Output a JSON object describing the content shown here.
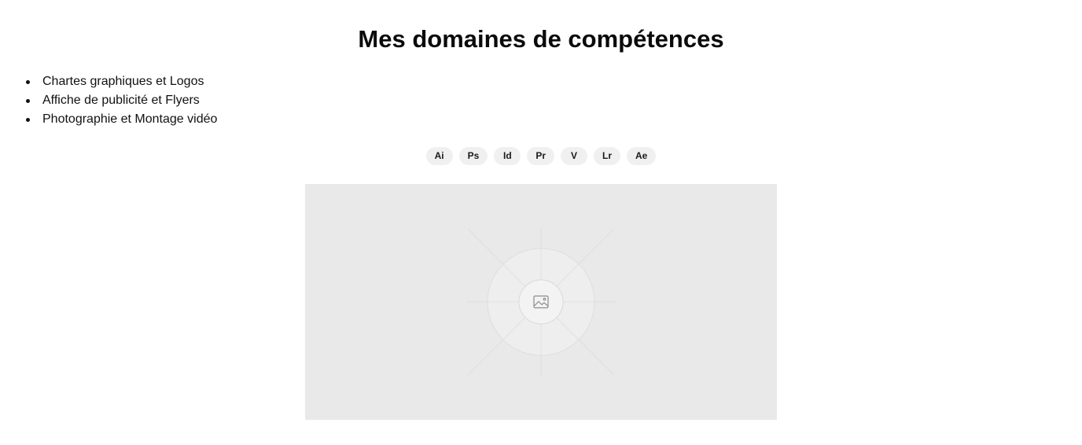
{
  "section": {
    "title": "Mes domaines de compétences"
  },
  "skills": {
    "items": [
      "Chartes graphiques et Logos",
      "Affiche de publicité et Flyers",
      "Photographie et Montage vidéo"
    ]
  },
  "software_tags": [
    "Ai",
    "Ps",
    "Id",
    "Pr",
    "V",
    "Lr",
    "Ae"
  ],
  "image": {
    "icon": "image-placeholder-icon"
  },
  "colors": {
    "placeholder_background": "#e9e9e9",
    "tag_background": "#f0f0f0",
    "text": "#111111"
  }
}
